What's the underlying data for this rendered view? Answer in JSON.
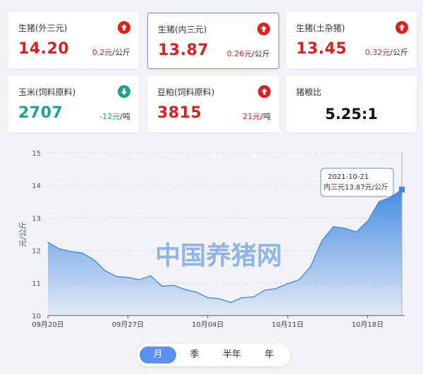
{
  "cards": [
    {
      "name": "生猪(外三元)",
      "price": "14.20",
      "change_value": "0.2元",
      "change_unit": "/公斤",
      "trend": "up"
    },
    {
      "name": "生猪(内三元)",
      "price": "13.87",
      "change_value": "0.26元",
      "change_unit": "/公斤",
      "trend": "up"
    },
    {
      "name": "生猪(土杂猪)",
      "price": "13.45",
      "change_value": "0.32元",
      "change_unit": "/公斤",
      "trend": "up"
    },
    {
      "name": "玉米(饲料原料)",
      "price": "2707",
      "change_value": "-12元",
      "change_unit": "/吨",
      "trend": "down"
    },
    {
      "name": "豆粕(饲料原料)",
      "price": "3815",
      "change_value": "21元",
      "change_unit": "/吨",
      "trend": "up"
    },
    {
      "name": "猪粮比",
      "price": "5.25:1"
    }
  ],
  "colors": {
    "up": "#e01e1e",
    "down": "#1ea386",
    "line": "#3f86e0",
    "tab_active": "#5b8ff0",
    "watermark": "#3f7fd6"
  },
  "icons": {
    "up": "arrow-up-circle-icon",
    "down": "arrow-down-circle-icon"
  },
  "chart_data": {
    "type": "area",
    "watermark": "中国养猪网",
    "ylabel": "元/公斤",
    "ylim": [
      10,
      15
    ],
    "yticks": [
      "10",
      "11",
      "12",
      "13",
      "14",
      "15"
    ],
    "x": [
      "09-20",
      "09-21",
      "09-22",
      "09-23",
      "09-24",
      "09-25",
      "09-26",
      "09-27",
      "09-28",
      "09-29",
      "09-30",
      "10-01",
      "10-02",
      "10-03",
      "10-04",
      "10-05",
      "10-06",
      "10-07",
      "10-08",
      "10-09",
      "10-10",
      "10-11",
      "10-12",
      "10-13",
      "10-14",
      "10-15",
      "10-16",
      "10-17",
      "10-18",
      "10-19",
      "10-20",
      "10-21"
    ],
    "xtick_labels": [
      {
        "label": "09月20日",
        "index": 0
      },
      {
        "label": "09月27日",
        "index": 7
      },
      {
        "label": "10月04日",
        "index": 14
      },
      {
        "label": "10月11日",
        "index": 21
      },
      {
        "label": "10月18日",
        "index": 28
      }
    ],
    "series": [
      {
        "name": "内三元",
        "values": [
          12.25,
          12.05,
          11.97,
          11.92,
          11.72,
          11.38,
          11.2,
          11.17,
          11.1,
          11.22,
          10.9,
          10.93,
          10.8,
          10.72,
          10.55,
          10.52,
          10.4,
          10.55,
          10.57,
          10.78,
          10.83,
          10.98,
          11.1,
          11.5,
          12.3,
          12.73,
          12.68,
          12.57,
          12.9,
          13.5,
          13.63,
          13.87
        ]
      }
    ],
    "tooltip": {
      "date": "2021-10-21",
      "text": "内三元13.87元/公斤"
    }
  },
  "tabs": [
    {
      "label": "月",
      "active": true
    },
    {
      "label": "季",
      "active": false
    },
    {
      "label": "半年",
      "active": false
    },
    {
      "label": "年",
      "active": false
    }
  ]
}
